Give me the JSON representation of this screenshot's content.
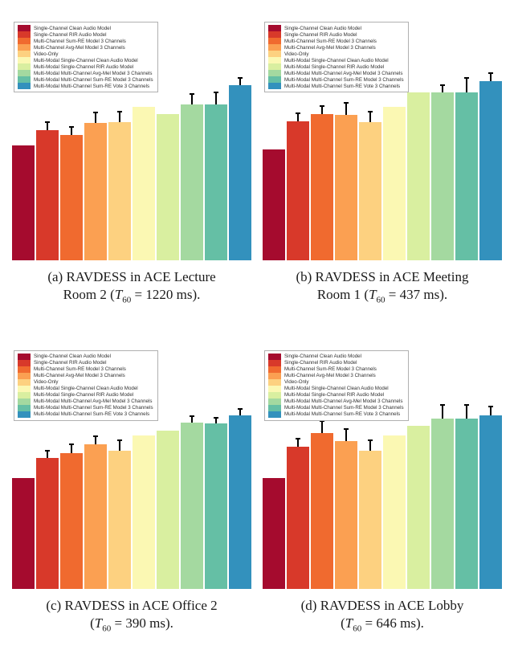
{
  "colors": [
    "#a50b2e",
    "#d8392a",
    "#f06a2f",
    "#fba052",
    "#fdd180",
    "#fbf8b3",
    "#d9efa0",
    "#a4d9a0",
    "#65bfa5",
    "#3391bd"
  ],
  "legend": [
    "Single-Channel Clean Audio Model",
    "Single-Channel RIR Audio Model",
    "Multi-Channel Sum-RE Model 3 Channels",
    "Multi-Channel Avg-Mel Model 3 Channels",
    "Video-Only",
    "Multi-Modal Single-Channel Clean Audio Model",
    "Multi-Modal Single-Channel RIR Audio Model",
    "Multi-Modal Multi-Channel Avg-Mel Model 3 Channels",
    "Multi-Modal Multi-Channel Sum-RE Model 3 Channels",
    "Multi-Modal Multi-Channel Sum-RE Vote 3 Channels"
  ],
  "ylim": 100,
  "charts": [
    {
      "letter": "(a)",
      "caption_l1": "RAVDESS in ACE Lecture",
      "caption_l2": "Room 2 (",
      "t60": "T",
      "t60sub": "60",
      "t60eq": " = 1220 ms).",
      "values": [
        48.5,
        55,
        53,
        58,
        58.5,
        65,
        62,
        66,
        66,
        74
      ],
      "errors": [
        0,
        3.5,
        3.5,
        4.7,
        4.3,
        0,
        0,
        4.3,
        5.1,
        3.2
      ]
    },
    {
      "letter": "(b)",
      "caption_l1": "RAVDESS in ACE Meeting",
      "caption_l2": "Room 1 (",
      "t60": "T",
      "t60sub": "60",
      "t60eq": " = 437 ms).",
      "values": [
        47,
        59,
        62,
        61.5,
        58.5,
        65,
        71,
        71,
        71,
        76
      ],
      "errors": [
        0,
        3.1,
        3.2,
        5.1,
        4.3,
        0,
        0,
        3.2,
        6.2,
        3.1
      ]
    },
    {
      "letter": "(c)",
      "caption_l1": "RAVDESS in ACE Office 2",
      "caption_l2": "(",
      "t60": "T",
      "t60sub": "60",
      "t60eq": " = 390 ms).",
      "values": [
        47,
        55.5,
        57.5,
        61,
        58.5,
        65,
        67,
        70.5,
        70,
        73.5
      ],
      "errors": [
        0,
        3.1,
        3.5,
        3.5,
        4.3,
        0,
        0,
        2.7,
        2.3,
        2.7
      ]
    },
    {
      "letter": "(d)",
      "caption_l1": "RAVDESS in ACE Lobby",
      "caption_l2": "(",
      "t60": "T",
      "t60sub": "60",
      "t60eq": " = 646 ms).",
      "values": [
        47,
        60,
        66,
        62.5,
        58.5,
        65,
        69,
        72,
        72,
        73.5
      ],
      "errors": [
        0,
        3.5,
        5.1,
        5.1,
        4.3,
        0,
        0,
        5.8,
        5.8,
        3.5
      ]
    }
  ],
  "chart_data": [
    {
      "type": "bar",
      "title": "",
      "xlabel": "",
      "ylabel": "",
      "ylim": [
        0,
        100
      ],
      "caption": "(a) RAVDESS in ACE Lecture Room 2 (T60 = 1220 ms).",
      "categories": [
        "Single-Channel Clean Audio Model",
        "Single-Channel RIR Audio Model",
        "Multi-Channel Sum-RE Model 3 Channels",
        "Multi-Channel Avg-Mel Model 3 Channels",
        "Video-Only",
        "Multi-Modal Single-Channel Clean Audio Model",
        "Multi-Modal Single-Channel RIR Audio Model",
        "Multi-Modal Multi-Channel Avg-Mel Model 3 Channels",
        "Multi-Modal Multi-Channel Sum-RE Model 3 Channels",
        "Multi-Modal Multi-Channel Sum-RE Vote 3 Channels"
      ],
      "values": [
        48.5,
        55,
        53,
        58,
        58.5,
        65,
        62,
        66,
        66,
        74
      ],
      "errors": [
        null,
        3.5,
        3.5,
        4.7,
        4.3,
        null,
        null,
        4.3,
        5.1,
        3.2
      ],
      "colors": [
        "#a50b2e",
        "#d8392a",
        "#f06a2f",
        "#fba052",
        "#fdd180",
        "#fbf8b3",
        "#d9efa0",
        "#a4d9a0",
        "#65bfa5",
        "#3391bd"
      ]
    },
    {
      "type": "bar",
      "title": "",
      "xlabel": "",
      "ylabel": "",
      "ylim": [
        0,
        100
      ],
      "caption": "(b) RAVDESS in ACE Meeting Room 1 (T60 = 437 ms).",
      "categories": [
        "Single-Channel Clean Audio Model",
        "Single-Channel RIR Audio Model",
        "Multi-Channel Sum-RE Model 3 Channels",
        "Multi-Channel Avg-Mel Model 3 Channels",
        "Video-Only",
        "Multi-Modal Single-Channel Clean Audio Model",
        "Multi-Modal Single-Channel RIR Audio Model",
        "Multi-Modal Multi-Channel Avg-Mel Model 3 Channels",
        "Multi-Modal Multi-Channel Sum-RE Model 3 Channels",
        "Multi-Modal Multi-Channel Sum-RE Vote 3 Channels"
      ],
      "values": [
        47,
        59,
        62,
        61.5,
        58.5,
        65,
        71,
        71,
        71,
        76
      ],
      "errors": [
        null,
        3.1,
        3.2,
        5.1,
        4.3,
        null,
        null,
        3.2,
        6.2,
        3.1
      ],
      "colors": [
        "#a50b2e",
        "#d8392a",
        "#f06a2f",
        "#fba052",
        "#fdd180",
        "#fbf8b3",
        "#d9efa0",
        "#a4d9a0",
        "#65bfa5",
        "#3391bd"
      ]
    },
    {
      "type": "bar",
      "title": "",
      "xlabel": "",
      "ylabel": "",
      "ylim": [
        0,
        100
      ],
      "caption": "(c) RAVDESS in ACE Office 2 (T60 = 390 ms).",
      "categories": [
        "Single-Channel Clean Audio Model",
        "Single-Channel RIR Audio Model",
        "Multi-Channel Sum-RE Model 3 Channels",
        "Multi-Channel Avg-Mel Model 3 Channels",
        "Video-Only",
        "Multi-Modal Single-Channel Clean Audio Model",
        "Multi-Modal Single-Channel RIR Audio Model",
        "Multi-Modal Multi-Channel Avg-Mel Model 3 Channels",
        "Multi-Modal Multi-Channel Sum-RE Model 3 Channels",
        "Multi-Modal Multi-Channel Sum-RE Vote 3 Channels"
      ],
      "values": [
        47,
        55.5,
        57.5,
        61,
        58.5,
        65,
        67,
        70.5,
        70,
        73.5
      ],
      "errors": [
        null,
        3.1,
        3.5,
        3.5,
        4.3,
        null,
        null,
        2.7,
        2.3,
        2.7
      ],
      "colors": [
        "#a50b2e",
        "#d8392a",
        "#f06a2f",
        "#fba052",
        "#fdd180",
        "#fbf8b3",
        "#d9efa0",
        "#a4d9a0",
        "#65bfa5",
        "#3391bd"
      ]
    },
    {
      "type": "bar",
      "title": "",
      "xlabel": "",
      "ylabel": "",
      "ylim": [
        0,
        100
      ],
      "caption": "(d) RAVDESS in ACE Lobby (T60 = 646 ms).",
      "categories": [
        "Single-Channel Clean Audio Model",
        "Single-Channel RIR Audio Model",
        "Multi-Channel Sum-RE Model 3 Channels",
        "Multi-Channel Avg-Mel Model 3 Channels",
        "Video-Only",
        "Multi-Modal Single-Channel Clean Audio Model",
        "Multi-Modal Single-Channel RIR Audio Model",
        "Multi-Modal Multi-Channel Avg-Mel Model 3 Channels",
        "Multi-Modal Multi-Channel Sum-RE Model 3 Channels",
        "Multi-Modal Multi-Channel Sum-RE Vote 3 Channels"
      ],
      "values": [
        47,
        60,
        66,
        62.5,
        58.5,
        65,
        69,
        72,
        72,
        73.5
      ],
      "errors": [
        null,
        3.5,
        5.1,
        5.1,
        4.3,
        null,
        null,
        5.8,
        5.8,
        3.5
      ],
      "colors": [
        "#a50b2e",
        "#d8392a",
        "#f06a2f",
        "#fba052",
        "#fdd180",
        "#fbf8b3",
        "#d9efa0",
        "#a4d9a0",
        "#65bfa5",
        "#3391bd"
      ]
    }
  ]
}
